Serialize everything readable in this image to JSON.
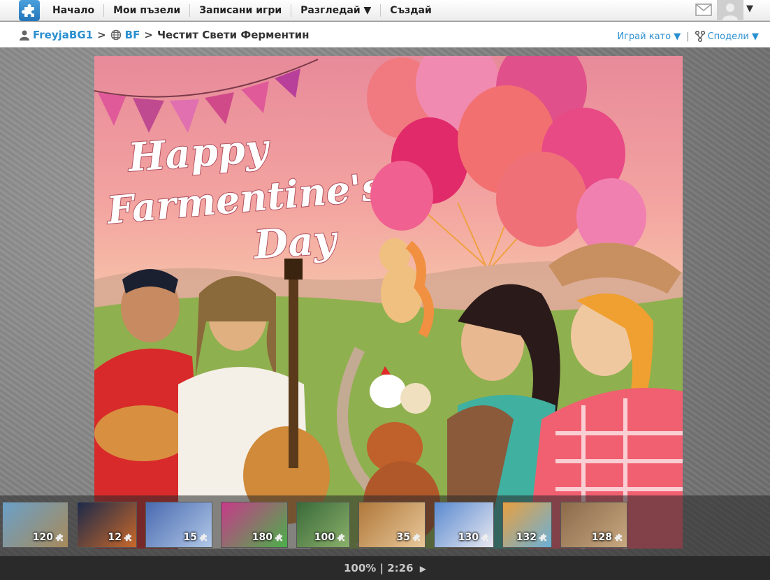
{
  "nav": {
    "items": [
      "Начало",
      "Мои пъзели",
      "Записани игри",
      "Разгледай ▼",
      "Създай"
    ]
  },
  "header": {
    "menu_caret": "▼"
  },
  "breadcrumb": {
    "user": "FreyjaBG1",
    "sep1": ">",
    "group": "BF",
    "sep2": ">",
    "title": "Честит Свети Ферментин"
  },
  "actions": {
    "play_as": "Играй като ▼",
    "divider": "|",
    "share": "Сподели ▼"
  },
  "puzzle_art": {
    "text_line1": "Happy",
    "text_line2": "Farmentine's",
    "text_line3": "Day"
  },
  "thumbnails": [
    {
      "count": "120",
      "color1": "#6aa0c8",
      "color2": "#a88a5a"
    },
    {
      "count": "12",
      "color1": "#1c2a4a",
      "color2": "#c8682a"
    },
    {
      "count": "15",
      "color1": "#4a6ab0",
      "color2": "#b0c8e8"
    },
    {
      "count": "180",
      "color1": "#c83a8a",
      "color2": "#4ab04a"
    },
    {
      "count": "100",
      "color1": "#3a6a3a",
      "color2": "#8ab06a"
    },
    {
      "count": "35",
      "color1": "#b0783a",
      "color2": "#e8c89a"
    },
    {
      "count": "130",
      "color1": "#5a8ad0",
      "color2": "#e8e8f0"
    },
    {
      "count": "132",
      "color1": "#e8a040",
      "color2": "#6ab0d8"
    },
    {
      "count": "128",
      "color1": "#8a6a4a",
      "color2": "#c8a880"
    }
  ],
  "status": {
    "progress": "100%",
    "divider": "|",
    "time": "2:26",
    "play_glyph": "▶"
  },
  "colors": {
    "link": "#2a8fd0",
    "topbar": "#f4f4f4",
    "stage": "#858585",
    "bottombar": "#2a2a2a"
  }
}
